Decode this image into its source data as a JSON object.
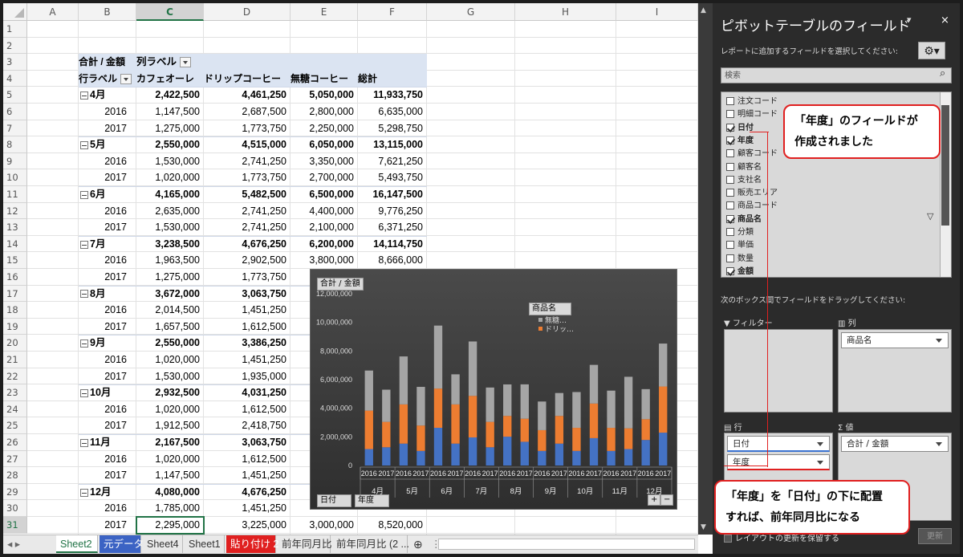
{
  "columns": [
    "A",
    "B",
    "C",
    "D",
    "E",
    "F",
    "G",
    "H",
    "I"
  ],
  "rows": [
    "1",
    "2",
    "3",
    "4",
    "5",
    "6",
    "7",
    "8",
    "9",
    "10",
    "11",
    "12",
    "13",
    "14",
    "15",
    "16",
    "17",
    "18",
    "19",
    "20",
    "21",
    "22",
    "23",
    "24",
    "25",
    "26",
    "27",
    "28",
    "29",
    "30",
    "31"
  ],
  "pivot": {
    "header1": [
      "合計 / 金額",
      "列ラベル"
    ],
    "header2": [
      "行ラベル",
      "カフェオーレ",
      "ドリップコーヒー",
      "無糖コーヒー",
      "総計"
    ],
    "body": [
      {
        "label": "4月",
        "group": true,
        "v": [
          "2,422,500",
          "4,461,250",
          "5,050,000",
          "11,933,750"
        ]
      },
      {
        "label": "2016",
        "v": [
          "1,147,500",
          "2,687,500",
          "2,800,000",
          "6,635,000"
        ]
      },
      {
        "label": "2017",
        "v": [
          "1,275,000",
          "1,773,750",
          "2,250,000",
          "5,298,750"
        ]
      },
      {
        "label": "5月",
        "group": true,
        "v": [
          "2,550,000",
          "4,515,000",
          "6,050,000",
          "13,115,000"
        ]
      },
      {
        "label": "2016",
        "v": [
          "1,530,000",
          "2,741,250",
          "3,350,000",
          "7,621,250"
        ]
      },
      {
        "label": "2017",
        "v": [
          "1,020,000",
          "1,773,750",
          "2,700,000",
          "5,493,750"
        ]
      },
      {
        "label": "6月",
        "group": true,
        "v": [
          "4,165,000",
          "5,482,500",
          "6,500,000",
          "16,147,500"
        ]
      },
      {
        "label": "2016",
        "v": [
          "2,635,000",
          "2,741,250",
          "4,400,000",
          "9,776,250"
        ]
      },
      {
        "label": "2017",
        "v": [
          "1,530,000",
          "2,741,250",
          "2,100,000",
          "6,371,250"
        ]
      },
      {
        "label": "7月",
        "group": true,
        "v": [
          "3,238,500",
          "4,676,250",
          "6,200,000",
          "14,114,750"
        ]
      },
      {
        "label": "2016",
        "v": [
          "1,963,500",
          "2,902,500",
          "3,800,000",
          "8,666,000"
        ]
      },
      {
        "label": "2017",
        "v": [
          "1,275,000",
          "1,773,750",
          "",
          ""
        ]
      },
      {
        "label": "8月",
        "group": true,
        "v": [
          "3,672,000",
          "3,063,750",
          "4",
          ""
        ]
      },
      {
        "label": "2016",
        "v": [
          "2,014,500",
          "1,451,250",
          "",
          ""
        ]
      },
      {
        "label": "2017",
        "v": [
          "1,657,500",
          "1,612,500",
          "",
          ""
        ]
      },
      {
        "label": "9月",
        "group": true,
        "v": [
          "2,550,000",
          "3,386,250",
          "4",
          ""
        ]
      },
      {
        "label": "2016",
        "v": [
          "1,020,000",
          "1,451,250",
          "",
          ""
        ]
      },
      {
        "label": "2017",
        "v": [
          "1,530,000",
          "1,935,000",
          "",
          ""
        ]
      },
      {
        "label": "10月",
        "group": true,
        "v": [
          "2,932,500",
          "4,031,250",
          "5",
          ""
        ]
      },
      {
        "label": "2016",
        "v": [
          "1,020,000",
          "1,612,500",
          "",
          ""
        ]
      },
      {
        "label": "2017",
        "v": [
          "1,912,500",
          "2,418,750",
          "",
          ""
        ]
      },
      {
        "label": "11月",
        "group": true,
        "v": [
          "2,167,500",
          "3,063,750",
          "6",
          ""
        ]
      },
      {
        "label": "2016",
        "v": [
          "1,020,000",
          "1,612,500",
          "",
          ""
        ]
      },
      {
        "label": "2017",
        "v": [
          "1,147,500",
          "1,451,250",
          "",
          ""
        ]
      },
      {
        "label": "12月",
        "group": true,
        "v": [
          "4,080,000",
          "4,676,250",
          "5",
          ""
        ]
      },
      {
        "label": "2016",
        "v": [
          "1,785,000",
          "1,451,250",
          "",
          ""
        ]
      },
      {
        "label": "2017",
        "v": [
          "2,295,000",
          "3,225,000",
          "3,000,000",
          "8,520,000"
        ]
      }
    ]
  },
  "chart_data": {
    "type": "bar",
    "stacked": true,
    "value_tag": "合計 / 金額",
    "legend_title": "商品名",
    "legend": [
      "無糖…",
      "ドリッ…"
    ],
    "filter_tags": [
      "日付",
      "年度"
    ],
    "yticks": [
      "12,000,000",
      "10,000,000",
      "8,000,000",
      "6,000,000",
      "4,000,000",
      "2,000,000",
      "0"
    ],
    "ylim": [
      0,
      12000000
    ],
    "months": [
      "4月",
      "5月",
      "6月",
      "7月",
      "8月",
      "9月",
      "10月",
      "11月",
      "12月"
    ],
    "years": [
      "2016",
      "2017"
    ],
    "series": [
      {
        "name": "カフェオーレ",
        "color": "#4472c4",
        "values": [
          1147500,
          1275000,
          1530000,
          1020000,
          2635000,
          1530000,
          1963500,
          1275000,
          2014500,
          1657500,
          1020000,
          1530000,
          1020000,
          1912500,
          1020000,
          1147500,
          1785000,
          2295000
        ]
      },
      {
        "name": "ドリップコーヒー",
        "color": "#ed7d31",
        "values": [
          2687500,
          1773750,
          2741250,
          1773750,
          2741250,
          2741250,
          2902500,
          1773750,
          1451250,
          1612500,
          1451250,
          1935000,
          1612500,
          2418750,
          1612500,
          1451250,
          1451250,
          3225000
        ]
      },
      {
        "name": "無糖コーヒー",
        "color": "#a5a5a5",
        "values": [
          2800000,
          2250000,
          3350000,
          2700000,
          4400000,
          2100000,
          3800000,
          2400000,
          2200000,
          2400000,
          2000000,
          1600000,
          2500000,
          2700000,
          2600000,
          3600000,
          2100000,
          3000000
        ]
      }
    ]
  },
  "sheet_tabs": [
    {
      "label": "Sheet2",
      "style": "active"
    },
    {
      "label": "元データ",
      "style": "blue"
    },
    {
      "label": "Sheet4",
      "style": "normal"
    },
    {
      "label": "Sheet1",
      "style": "normal"
    },
    {
      "label": "貼り付け 2",
      "style": "red"
    },
    {
      "label": "前年同月比",
      "style": "normal"
    },
    {
      "label": "前年同月比 (2 ...",
      "style": "normal"
    }
  ],
  "pane": {
    "title": "ピボットテーブルのフィールド",
    "subtitle": "レポートに追加するフィールドを選択してください:",
    "search_placeholder": "検索",
    "fields": [
      {
        "name": "注文コード",
        "checked": false
      },
      {
        "name": "明細コード",
        "checked": false
      },
      {
        "name": "日付",
        "checked": true
      },
      {
        "name": "年度",
        "checked": true
      },
      {
        "name": "顧客コード",
        "checked": false
      },
      {
        "name": "顧客名",
        "checked": false
      },
      {
        "name": "支社名",
        "checked": false
      },
      {
        "name": "販売エリア",
        "checked": false
      },
      {
        "name": "商品コード",
        "checked": false
      },
      {
        "name": "商品名",
        "checked": true
      },
      {
        "name": "分類",
        "checked": false
      },
      {
        "name": "単価",
        "checked": false
      },
      {
        "name": "数量",
        "checked": false
      },
      {
        "name": "金額",
        "checked": true
      }
    ],
    "drag_hint": "次のボックス間でフィールドをドラッグしてください:",
    "filter_label": "フィルター",
    "columns_label": "列",
    "rows_label": "行",
    "values_label": "値",
    "column_field": "商品名",
    "row_fields": [
      "日付",
      "年度"
    ],
    "value_field": "合計 / 金額",
    "defer_label": "レイアウトの更新を保留する",
    "update_label": "更新"
  },
  "callouts": {
    "top": [
      "「年度」のフィールドが",
      "作成されました"
    ],
    "bottom": [
      "「年度」を「日付」の下に配置",
      "すれば、前年同月比になる"
    ]
  }
}
